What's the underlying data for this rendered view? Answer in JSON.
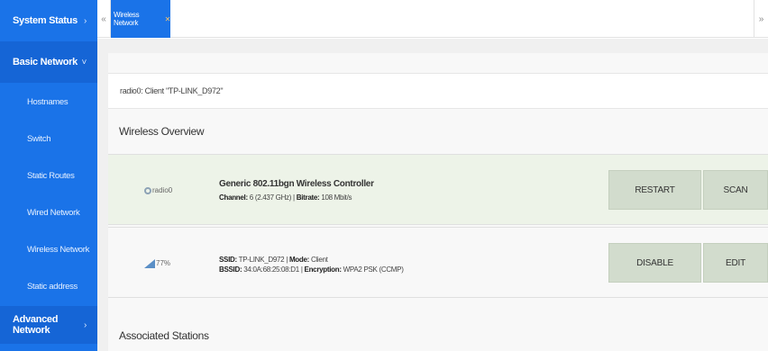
{
  "sidebar": {
    "system_status": "System Status",
    "basic_network": "Basic Network",
    "items": [
      {
        "label": "Hostnames"
      },
      {
        "label": "Switch"
      },
      {
        "label": "Static Routes"
      },
      {
        "label": "Wired Network"
      },
      {
        "label": "Wireless Network"
      },
      {
        "label": "Static address"
      }
    ],
    "advanced_network": "Advanced Network",
    "arrow_right": "›",
    "arrow_down": "˅"
  },
  "tabs": {
    "left_nav": "«",
    "right_nav": "»",
    "active": "Wireless Network",
    "close": "✕"
  },
  "main": {
    "client_line": "radio0: Client \"TP-LINK_D972\"",
    "overview_title": "Wireless Overview",
    "controller": {
      "icon_label": "radio0",
      "title": "Generic 802.11bgn Wireless Controller",
      "channel_label": "Channel:",
      "channel_value": "6 (2.437 GHz)",
      "sep": "|",
      "bitrate_label": "Bitrate:",
      "bitrate_value": "108 Mbit/s",
      "restart_label": "RESTART",
      "scan_label": "SCAN"
    },
    "network": {
      "signal_label": "77%",
      "ssid_label": "SSID:",
      "ssid_value": "TP-LINK_D972",
      "sep": "|",
      "mode_label": "Mode:",
      "mode_value": "Client",
      "bssid_label": "BSSID:",
      "bssid_value": "34:0A:68:25:08:D1",
      "encryption_label": "Encryption:",
      "encryption_value": "WPA2 PSK (CCMP)",
      "disable_label": "DISABLE",
      "edit_label": "EDIT"
    },
    "associated_title": "Associated Stations"
  },
  "colors": {
    "accent": "#1a73e8",
    "action_button": "#d2dccd",
    "controller_row": "#edf3e8"
  }
}
